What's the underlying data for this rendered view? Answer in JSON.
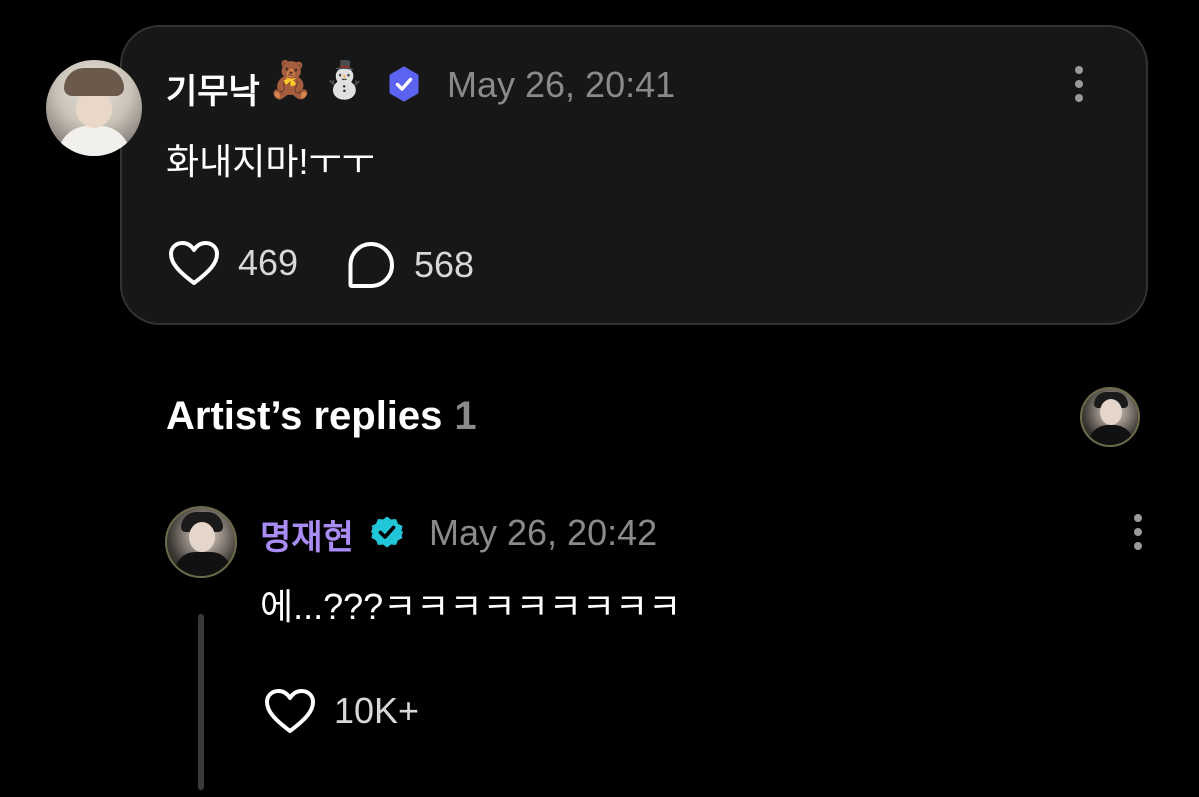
{
  "post": {
    "username": "기무낙",
    "emojis": [
      "🧸",
      "⛄"
    ],
    "timestamp": "May 26, 20:41",
    "text": "화내지마!ㅜㅜ",
    "likes": "469",
    "comments": "568"
  },
  "artist_replies": {
    "title": "Artist’s replies",
    "count": "1"
  },
  "reply": {
    "username": "명재현",
    "timestamp": "May 26, 20:42",
    "text": "에...???ㅋㅋㅋㅋㅋㅋㅋㅋㅋ",
    "likes": "10K+"
  },
  "colors": {
    "background": "#000000",
    "card": "#171717",
    "artist_name": "#a98cf5",
    "fan_badge": "#5b63f0",
    "artist_badge": "#21c7d9",
    "muted": "#8a8a8a"
  }
}
